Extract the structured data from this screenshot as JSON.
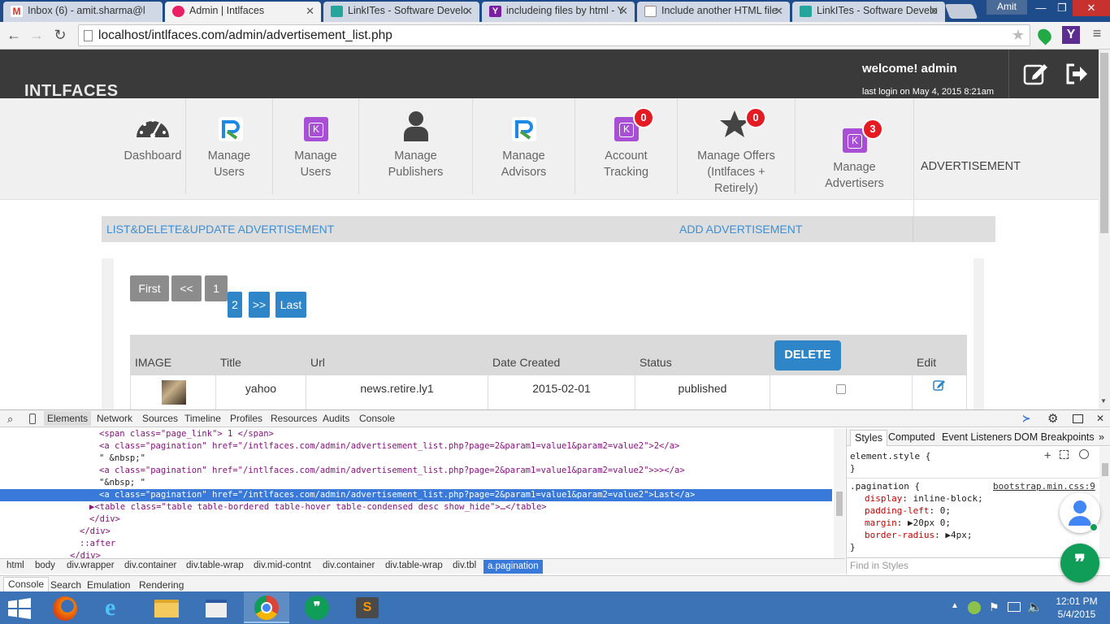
{
  "browser": {
    "tabs": [
      {
        "title": "Inbox (6) - amit.sharma@l",
        "icon_color": "#d93025"
      },
      {
        "title": "Admin | Intlfaces",
        "icon_color": "#e91e63"
      },
      {
        "title": "LinkITes - Software Develo",
        "icon_color": "#26a69a"
      },
      {
        "title": "includeing files by html - Y",
        "icon_color": "#7b1fa2"
      },
      {
        "title": "Include another HTML file",
        "icon_color": "#a1887f"
      },
      {
        "title": "LinkITes - Software Develo",
        "icon_color": "#26a69a"
      }
    ],
    "user": "Amit",
    "url": "localhost/intlfaces.com/admin/advertisement_list.php"
  },
  "site": {
    "brand": "INTLFACES",
    "welcome": "welcome! admin",
    "last_login": "last login on May 4, 2015 8:21am",
    "nav": [
      {
        "line1": "Dashboard",
        "line2": "",
        "line3": "",
        "icon": "dashboard-icon"
      },
      {
        "line1": "Manage",
        "line2": "Users",
        "line3": "",
        "icon": "r-logo-icon"
      },
      {
        "line1": "Manage",
        "line2": "Users",
        "line3": "",
        "icon": "k-logo-icon"
      },
      {
        "line1": "Manage",
        "line2": "Publishers",
        "line3": "",
        "icon": "person-icon"
      },
      {
        "line1": "Manage",
        "line2": "Advisors",
        "line3": "",
        "icon": "r-logo-icon"
      },
      {
        "line1": "Account",
        "line2": "Tracking",
        "line3": "",
        "icon": "k-logo-icon",
        "badge": "0"
      },
      {
        "line1": "Manage Offers",
        "line2": "(Intlfaces +",
        "line3": "Retirely)",
        "icon": "star-icon",
        "badge": "0"
      },
      {
        "line1": "Manage",
        "line2": "Advertisers",
        "line3": "",
        "icon": "k-logo-icon",
        "badge": "3"
      }
    ],
    "current_section": "ADVERTISEMENT",
    "subnav": {
      "list_label": "LIST&DELETE&UPDATE ADVERTISEMENT",
      "add_label": "ADD ADVERTISEMENT"
    },
    "pagination": {
      "first": "First",
      "prev": "<<",
      "current": "1",
      "next_page": "2",
      "next": ">>",
      "last": "Last"
    },
    "table": {
      "headers": [
        "IMAGE",
        "Title",
        "Url",
        "Date Created",
        "Status",
        "Edit"
      ],
      "delete_label": "DELETE",
      "rows": [
        {
          "title": "yahoo",
          "url": "news.retire.ly1",
          "date": "2015-02-01",
          "status": "published"
        }
      ]
    }
  },
  "devtools": {
    "tabs": [
      "Elements",
      "Network",
      "Sources",
      "Timeline",
      "Profiles",
      "Resources",
      "Audits",
      "Console"
    ],
    "code_lines": [
      {
        "text": "<span class=\"page_link\"> 1 </span>",
        "indent": 122
      },
      {
        "text": "<a class=\"pagination\" href=\"/intlfaces.com/admin/advertisement_list.php?page=2&param1=value1&param2=value2\">2</a>",
        "indent": 122
      },
      {
        "text": "\" &nbsp;\"",
        "indent": 122
      },
      {
        "text": "<a class=\"pagination\" href=\"/intlfaces.com/admin/advertisement_list.php?page=2&param1=value1&param2=value2\">>></a>",
        "indent": 122
      },
      {
        "text": "\"&nbsp; \"",
        "indent": 122
      },
      {
        "text": "<a class=\"pagination\" href=\"/intlfaces.com/admin/advertisement_list.php?page=2&param1=value1&param2=value2\">Last</a>",
        "indent": 122,
        "selected": true
      },
      {
        "text": "▶<table class=\"table table-bordered table-hover table-condensed desc show_hide\">…</table>",
        "indent": 110
      },
      {
        "text": "</div>",
        "indent": 110
      },
      {
        "text": "</div>",
        "indent": 98
      },
      {
        "text": "::after",
        "indent": 98
      },
      {
        "text": "</div>",
        "indent": 86
      }
    ],
    "breadcrumbs": [
      "html",
      "body",
      "div.wrapper",
      "div.container",
      "div.table-wrap",
      "div.mid-contnt",
      "div.container",
      "div.table-wrap",
      "div.tbl",
      "a.pagination"
    ],
    "styles_tabs": [
      "Styles",
      "Computed",
      "Event Listeners",
      "DOM Breakpoints"
    ],
    "element_style": "element.style {",
    "close_brace": "}",
    "rule_selector": ".pagination {",
    "rule_source": "bootstrap.min.css:9",
    "rule_props": [
      {
        "prop": "display",
        "value": "inline-block;"
      },
      {
        "prop": "padding-left",
        "value": "0;"
      },
      {
        "prop": "margin",
        "value": "▶20px 0;"
      },
      {
        "prop": "border-radius",
        "value": "▶4px;"
      }
    ],
    "find_placeholder": "Find in Styles",
    "drawer_tabs": [
      "Console",
      "Search",
      "Emulation",
      "Rendering"
    ]
  },
  "taskbar": {
    "time": "12:01 PM",
    "date": "5/4/2015"
  }
}
